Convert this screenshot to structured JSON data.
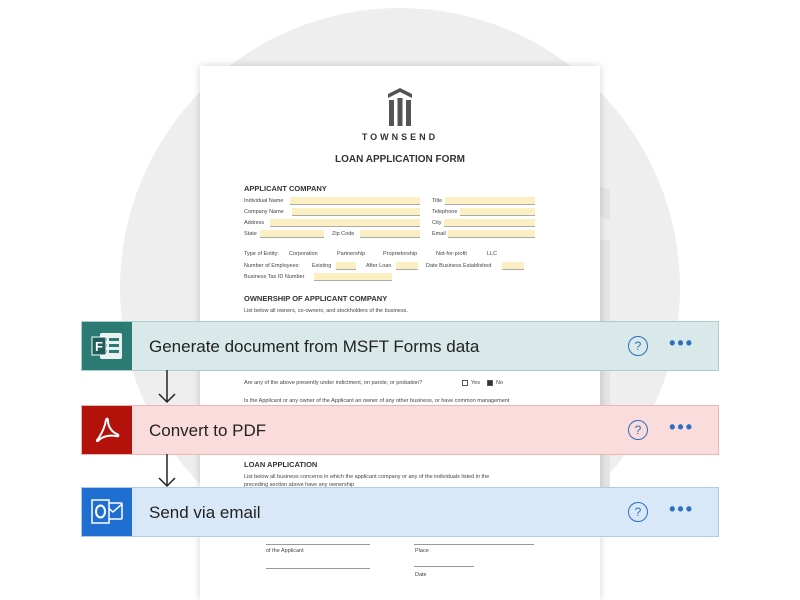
{
  "document": {
    "brand": "TOWNSEND",
    "title": "LOAN APPLICATION FORM",
    "applicant_section": "APPLICANT COMPANY",
    "fields_left": [
      "Individual Name",
      "Company Name",
      "Address",
      "State"
    ],
    "fields_right": [
      "Title",
      "Telephone",
      "City",
      "Email"
    ],
    "zip_label": "Zip Code",
    "entity_label": "Type of Entity:",
    "entity_options": [
      "Corporation",
      "Partnership",
      "Proprietorship",
      "Not-for-profit",
      "LLC"
    ],
    "employees_label": "Number of Employees:",
    "existing_label": "Existing",
    "after_loan_label": "After Loan",
    "date_established_label": "Date Business Established",
    "tax_id_label": "Business Tax ID Number",
    "ownership_section": "OWNERSHIP OF APPLICANT COMPANY",
    "ownership_text": "List below all owners, co-owners, and stockholders of the business.",
    "indictment_question": "Are any of the above presently under indictment, on parole, or probation?",
    "yes_label": "Yes",
    "no_label": "No",
    "applicant_owner_text": "Is the Applicant or any owner of the Applicant an owner of any other business, or have common management",
    "loan_section": "LOAN APPLICATION",
    "loan_text_1": "List below all business concerns in which the applicant company or any of the individuals listed in the",
    "loan_text_2": "preceding section above have any ownership",
    "signature_label": "of the Applicant",
    "place_label": "Place",
    "date_label": "Date"
  },
  "flow": {
    "steps": [
      {
        "label": "Generate document from MSFT Forms data",
        "icon": "forms-icon",
        "accent": "#2b7a73",
        "bg": "#d9e9e9",
        "border": "#a9cfcc"
      },
      {
        "label": "Convert to PDF",
        "icon": "pdf-icon",
        "accent": "#b3120b",
        "bg": "#fbdcdc",
        "border": "#efb3b3"
      },
      {
        "label": "Send via email",
        "icon": "outlook-icon",
        "accent": "#1e6fd1",
        "bg": "#d9e8f8",
        "border": "#aecbec"
      }
    ],
    "help_symbol": "?",
    "more_symbol": "•••"
  }
}
